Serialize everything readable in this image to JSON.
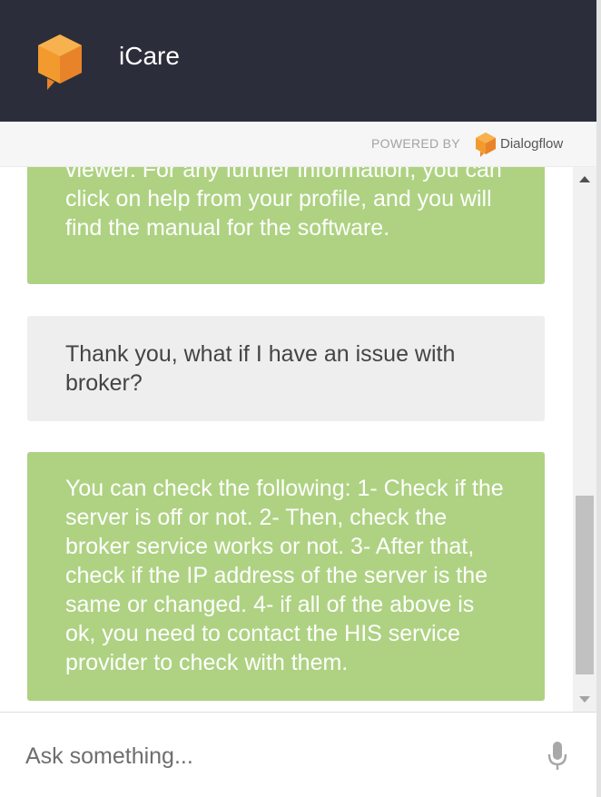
{
  "header": {
    "title": "iCare",
    "logo_icon": "chat-cube-logo-icon",
    "background_color": "#2b2e3a"
  },
  "powered_by": {
    "label": "POWERED BY",
    "brand": "Dialogflow",
    "brand_icon": "dialogflow-logo-icon"
  },
  "messages": [
    {
      "sender": "bot",
      "text": "in the interface bar at the bottom of the viewer. For any further information, you can click on help from your profile, and you will find the manual for the software."
    },
    {
      "sender": "user",
      "text": "Thank you, what if I have an issue with broker?"
    },
    {
      "sender": "bot",
      "text": "You can check the following: 1- Check if the server is off or not. 2- Then, check the broker service works or not. 3- After that, check if the IP address of the server is the same or changed. 4- if all of the above is ok, you need to contact the HIS service provider to check with them."
    }
  ],
  "input": {
    "placeholder": "Ask something...",
    "value": "",
    "mic_icon": "microphone-icon"
  },
  "colors": {
    "bot_bubble": "#aed282",
    "user_bubble": "#eeeeee",
    "accent_orange": "#f29a2e"
  }
}
